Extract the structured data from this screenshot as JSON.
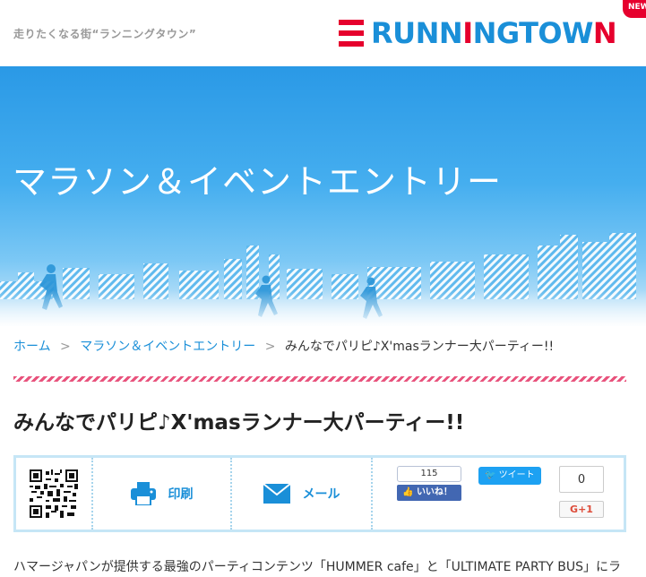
{
  "header": {
    "tagline": "走りたくなる街“ランニングタウン”",
    "logo_parts": [
      "RUNN",
      "I",
      "NGTOW",
      "N"
    ],
    "new_badge": "NEW"
  },
  "hero": {
    "title": "マラソン＆イベントエントリー"
  },
  "breadcrumb": {
    "home": "ホーム",
    "separator": ">",
    "category": "マラソン＆イベントエントリー",
    "current": "みんなでパリピ♪X'masランナー大パーティー!!"
  },
  "article": {
    "title": "みんなでパリピ♪X'masランナー大パーティー!!",
    "intro": "ハマージャパンが提供する最強のパーティコンテンツ「HUMMER cafe」と「ULTIMATE PARTY BUS」にラ"
  },
  "share": {
    "print_label": "印刷",
    "mail_label": "メール",
    "fb_count": "115",
    "fb_label": "いいね！",
    "tweet_label": "ツイート",
    "gplus_count": "0",
    "gplus_label": "G+1"
  },
  "colors": {
    "brand_blue": "#1a8fd8",
    "brand_red": "#e6002d",
    "stripe_pink": "#e8527c"
  }
}
